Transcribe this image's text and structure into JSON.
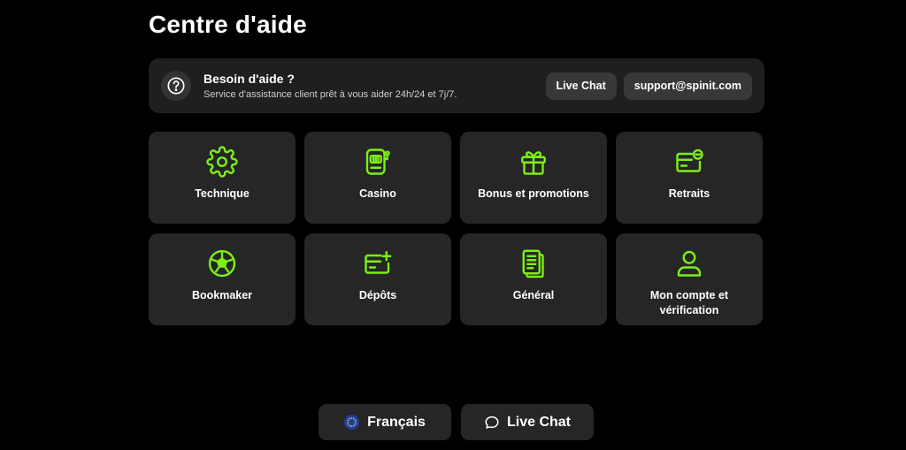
{
  "page": {
    "title": "Centre d'aide"
  },
  "help": {
    "title": "Besoin d'aide ?",
    "subtitle": "Service d'assistance client prêt à vous aider 24h/24 et 7j/7.",
    "live_chat_label": "Live Chat",
    "email_label": "support@spinit.com"
  },
  "categories": [
    {
      "label": "Technique",
      "icon": "gear-icon"
    },
    {
      "label": "Casino",
      "icon": "slot-machine-icon"
    },
    {
      "label": "Bonus et promotions",
      "icon": "gift-icon"
    },
    {
      "label": "Retraits",
      "icon": "card-minus-icon"
    },
    {
      "label": "Bookmaker",
      "icon": "soccer-ball-icon"
    },
    {
      "label": "Dépôts",
      "icon": "card-plus-icon"
    },
    {
      "label": "Général",
      "icon": "document-icon"
    },
    {
      "label": "Mon compte et vérification",
      "icon": "user-icon"
    }
  ],
  "footer": {
    "language_label": "Français",
    "live_chat_label": "Live Chat"
  },
  "colors": {
    "accent": "#7cf014",
    "card": "#262626",
    "bar": "#1f1f1f"
  }
}
